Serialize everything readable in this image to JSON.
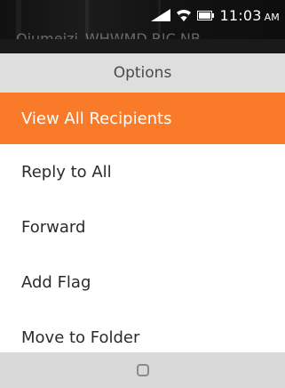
{
  "status_bar": {
    "time": "11:03",
    "ampm": "AM",
    "icons": [
      "signal-icon",
      "wifi-icon",
      "battery-icon"
    ]
  },
  "background": {
    "subject_text": "Qiumeizi_WHWMD RIC NB"
  },
  "sheet": {
    "title": "Options",
    "items": [
      {
        "label": "View All Recipients",
        "selected": true
      },
      {
        "label": "Reply to All",
        "selected": false
      },
      {
        "label": "Forward",
        "selected": false
      },
      {
        "label": "Add Flag",
        "selected": false
      },
      {
        "label": "Move to Folder",
        "selected": false
      }
    ]
  },
  "softkeys": {
    "center_icon": "select-key-icon"
  },
  "colors": {
    "accent": "#f97a28",
    "header_bg": "#dedede",
    "softkey_bg": "#d9d9d9"
  }
}
